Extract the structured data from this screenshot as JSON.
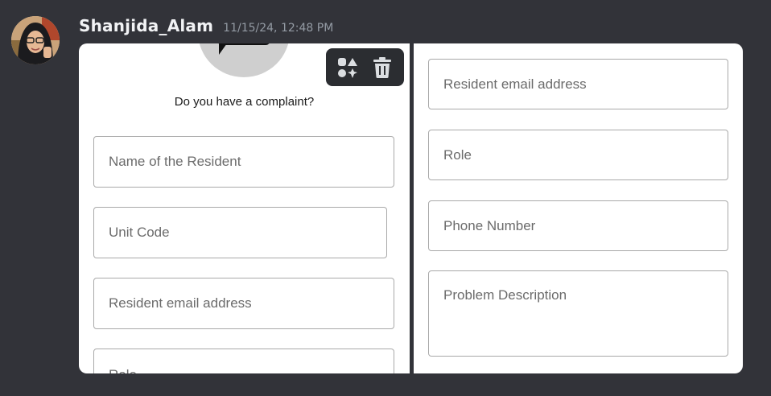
{
  "message": {
    "username": "Shanjida_Alam",
    "timestamp": "11/15/24, 12:48 PM"
  },
  "toolbar": {
    "icons": [
      "shapes-icon",
      "trash-icon"
    ]
  },
  "left_image": {
    "title": "Do you have a complaint?",
    "fields": {
      "name": "Name of the Resident",
      "unit": "Unit Code",
      "email": "Resident email address",
      "role": "Role"
    }
  },
  "right_image": {
    "fields": {
      "email": "Resident email address",
      "role": "Role",
      "phone": "Phone Number",
      "description": "Problem Description"
    }
  },
  "colors": {
    "background": "#323339",
    "username": "#f2f3f5",
    "timestamp": "#949ba4",
    "toolbar": "#2b2d31"
  }
}
